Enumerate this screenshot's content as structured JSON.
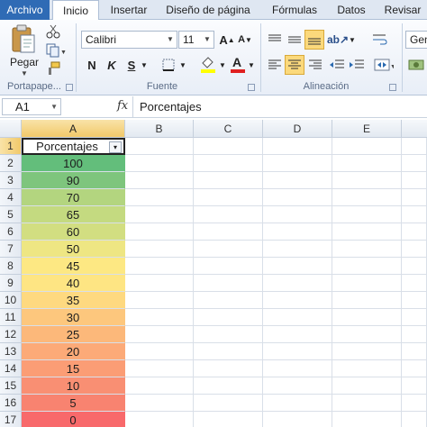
{
  "tabs": [
    "Archivo",
    "Inicio",
    "Insertar",
    "Diseño de página",
    "Fórmulas",
    "Datos",
    "Revisar"
  ],
  "ribbon": {
    "paste_label": "Pegar",
    "groups": [
      "Portapape...",
      "Fuente",
      "Alineación"
    ],
    "font_name": "Calibri",
    "font_size": "11",
    "number_format": "Gen",
    "bold": "N",
    "italic": "K",
    "underline": "S"
  },
  "formula_bar": {
    "name_box": "A1",
    "fx": "fx",
    "value": "Porcentajes"
  },
  "columns": [
    "A",
    "B",
    "C",
    "D",
    "E"
  ],
  "rows": [
    "1",
    "2",
    "3",
    "4",
    "5",
    "6",
    "7",
    "8",
    "9",
    "10",
    "11",
    "12",
    "13",
    "14",
    "15",
    "16",
    "17"
  ],
  "header_cell": "Porcentajes",
  "values": [
    "100",
    "90",
    "70",
    "65",
    "60",
    "50",
    "45",
    "40",
    "35",
    "30",
    "25",
    "20",
    "15",
    "10",
    "5",
    "0"
  ],
  "colors": {
    "tab_file": "#2f6bb5",
    "scale": [
      "#63be7b",
      "#7ec57d",
      "#b3d57f",
      "#c4da80",
      "#d2de81",
      "#eee683",
      "#fde883",
      "#fee583",
      "#fed980",
      "#fdc77d",
      "#fcb87a",
      "#fcaa78",
      "#fb9d75",
      "#f98f73",
      "#f88370",
      "#f8696b"
    ]
  }
}
